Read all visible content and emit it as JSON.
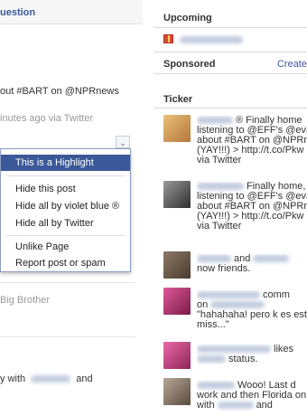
{
  "left": {
    "question_link": "uestion",
    "post_text": "out #BART on @NPRnews",
    "post_meta": "inutes ago via Twitter",
    "dropdown_arrow": "⌄",
    "menu": {
      "items": [
        {
          "label": "This is a Highlight",
          "highlighted": true
        },
        {
          "label": "Hide this post",
          "highlighted": false
        },
        {
          "label": "Hide all by violet blue ®",
          "highlighted": false
        },
        {
          "label": "Hide all by Twitter",
          "highlighted": false
        },
        {
          "label": "Unlike Page",
          "highlighted": false
        },
        {
          "label": "Report post or spam",
          "highlighted": false
        }
      ]
    },
    "big_brother_text": "Big Brother",
    "bottom_text_prefix": "y with",
    "bottom_text_suffix": "and"
  },
  "right": {
    "upcoming_title": "Upcoming",
    "sponsored_title": "Sponsored",
    "create_label": "Create",
    "ticker_title": "Ticker",
    "ticker": [
      {
        "lines": [
          "® Finally home",
          "listening to @EFF's @evaci",
          "about #BART on @NPRnew",
          "(YAY!!!) > http://t.co/Pkw",
          "via Twitter"
        ],
        "avatar_color": "#d9a25a"
      },
      {
        "lines": [
          "Finally home,",
          "listening to @EFF's @evaci",
          "about #BART on @NPRnew",
          "(YAY!!!) > http://t.co/Pkw",
          "via Twitter"
        ],
        "avatar_color": "#5a5a5a"
      },
      {
        "lines": [
          "and",
          "now friends."
        ],
        "avatar_color": "#6b5a4a"
      },
      {
        "lines": [
          "comm",
          "on",
          "\"hahahaha! pero k es estol",
          "miss...\""
        ],
        "avatar_color": "#b0306a"
      },
      {
        "lines": [
          "likes",
          "status."
        ],
        "avatar_color": "#c03878"
      },
      {
        "lines": [
          "Wooo! Last d",
          "work and then Florida on",
          "with",
          "and"
        ],
        "avatar_color": "#7a6a5a"
      }
    ]
  }
}
